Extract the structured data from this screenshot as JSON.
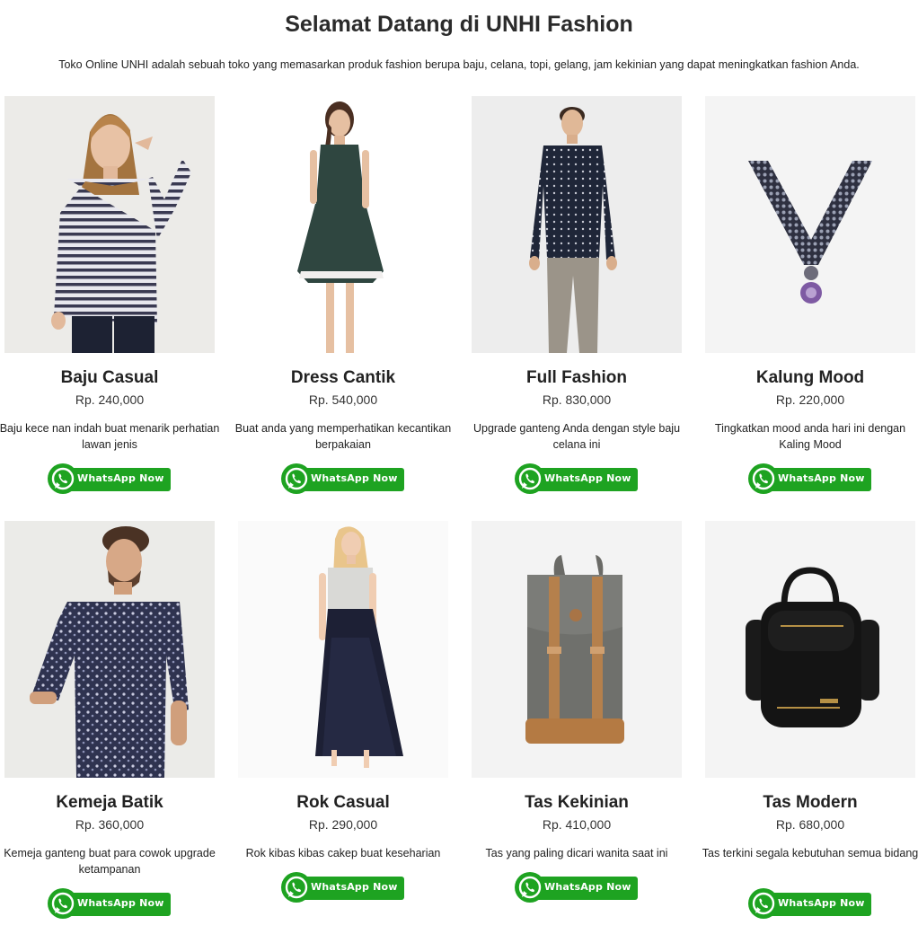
{
  "header": {
    "title": "Selamat Datang di UNHI Fashion",
    "intro": "Toko Online UNHI adalah sebuah toko yang memasarkan produk fashion berupa baju, celana, topi, gelang, jam kekinian yang dapat meningkatkan fashion Anda."
  },
  "button_label": "WhatsApp Now",
  "colors": {
    "whatsapp_green": "#1ea321"
  },
  "products": [
    {
      "name": "Baju Casual",
      "price": "Rp. 240,000",
      "description": "Baju kece nan indah buat menarik perhatian lawan jenis",
      "image": "woman-striped-sweater-photo"
    },
    {
      "name": "Dress Cantik",
      "price": "Rp. 540,000",
      "description": "Buat anda yang memperhatikan kecantikan berpakaian",
      "image": "woman-green-dress-photo"
    },
    {
      "name": "Full Fashion",
      "price": "Rp. 830,000",
      "description": "Upgrade ganteng Anda dengan style baju celana ini",
      "image": "man-dotted-shirt-photo"
    },
    {
      "name": "Kalung Mood",
      "price": "Rp. 220,000",
      "description": "Tingkatkan mood anda hari ini dengan Kaling Mood",
      "image": "chain-necklace-photo"
    },
    {
      "name": "Kemeja Batik",
      "price": "Rp. 360,000",
      "description": "Kemeja ganteng buat para cowok upgrade ketampanan",
      "image": "man-batik-shirt-photo"
    },
    {
      "name": "Rok Casual",
      "price": "Rp. 290,000",
      "description": "Rok kibas kibas cakep buat keseharian",
      "image": "woman-long-skirt-photo"
    },
    {
      "name": "Tas Kekinian",
      "price": "Rp. 410,000",
      "description": "Tas yang paling dicari wanita saat ini",
      "image": "canvas-backpack-photo"
    },
    {
      "name": "Tas Modern",
      "price": "Rp. 680,000",
      "description": "Tas terkini segala kebutuhan semua bidang",
      "image": "black-backpack-photo"
    }
  ]
}
